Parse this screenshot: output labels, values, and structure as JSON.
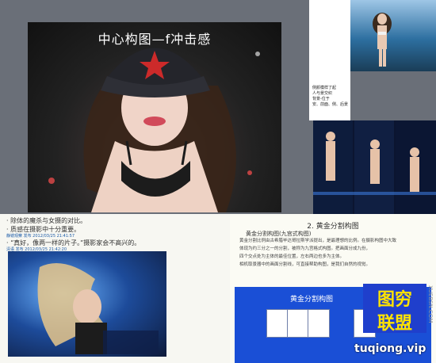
{
  "main_panel": {
    "title": "中心构图—f冲击感"
  },
  "notes_panel": {
    "lines": [
      "侧颜模样了起",
      "人与景交织",
      "背景-位于",
      "安、前面、侧、后景"
    ]
  },
  "text_panel": {
    "line1": "· 除体的魔杀与女摄的对比。",
    "line2": "· 质感在摄影中十分重要。",
    "meta1": "静镜观察 发布 2012/03/25 21:41:57",
    "meta2": "清语 发布 2012/03/25 21:42:20",
    "quote": "· “真好，像两一样的片子。”摄影家会不高兴的。"
  },
  "slide": {
    "heading": "2. 黄金分割构图",
    "sub": "黄金分割构图(九宫式构图)",
    "body": [
      "黄金分割比例由古希腊毕达哥拉斯学派提出，是最理想的比例。在摄影构图中大致",
      "体现为约三分之一的分割，被称为九宫格式构图。把画面分成九份，",
      "四个交点处为主体的最佳位置，左右两边也多为主体。",
      "相机取景器中的画面分割线，可直接帮助构图，是我们自然的视觉。"
    ],
    "box_title": "黄金分割构图"
  },
  "watermark": {
    "line1": "图穷",
    "line2": "联盟",
    "url": "tuqiong.vip",
    "side": "XUEBSN.COM"
  }
}
